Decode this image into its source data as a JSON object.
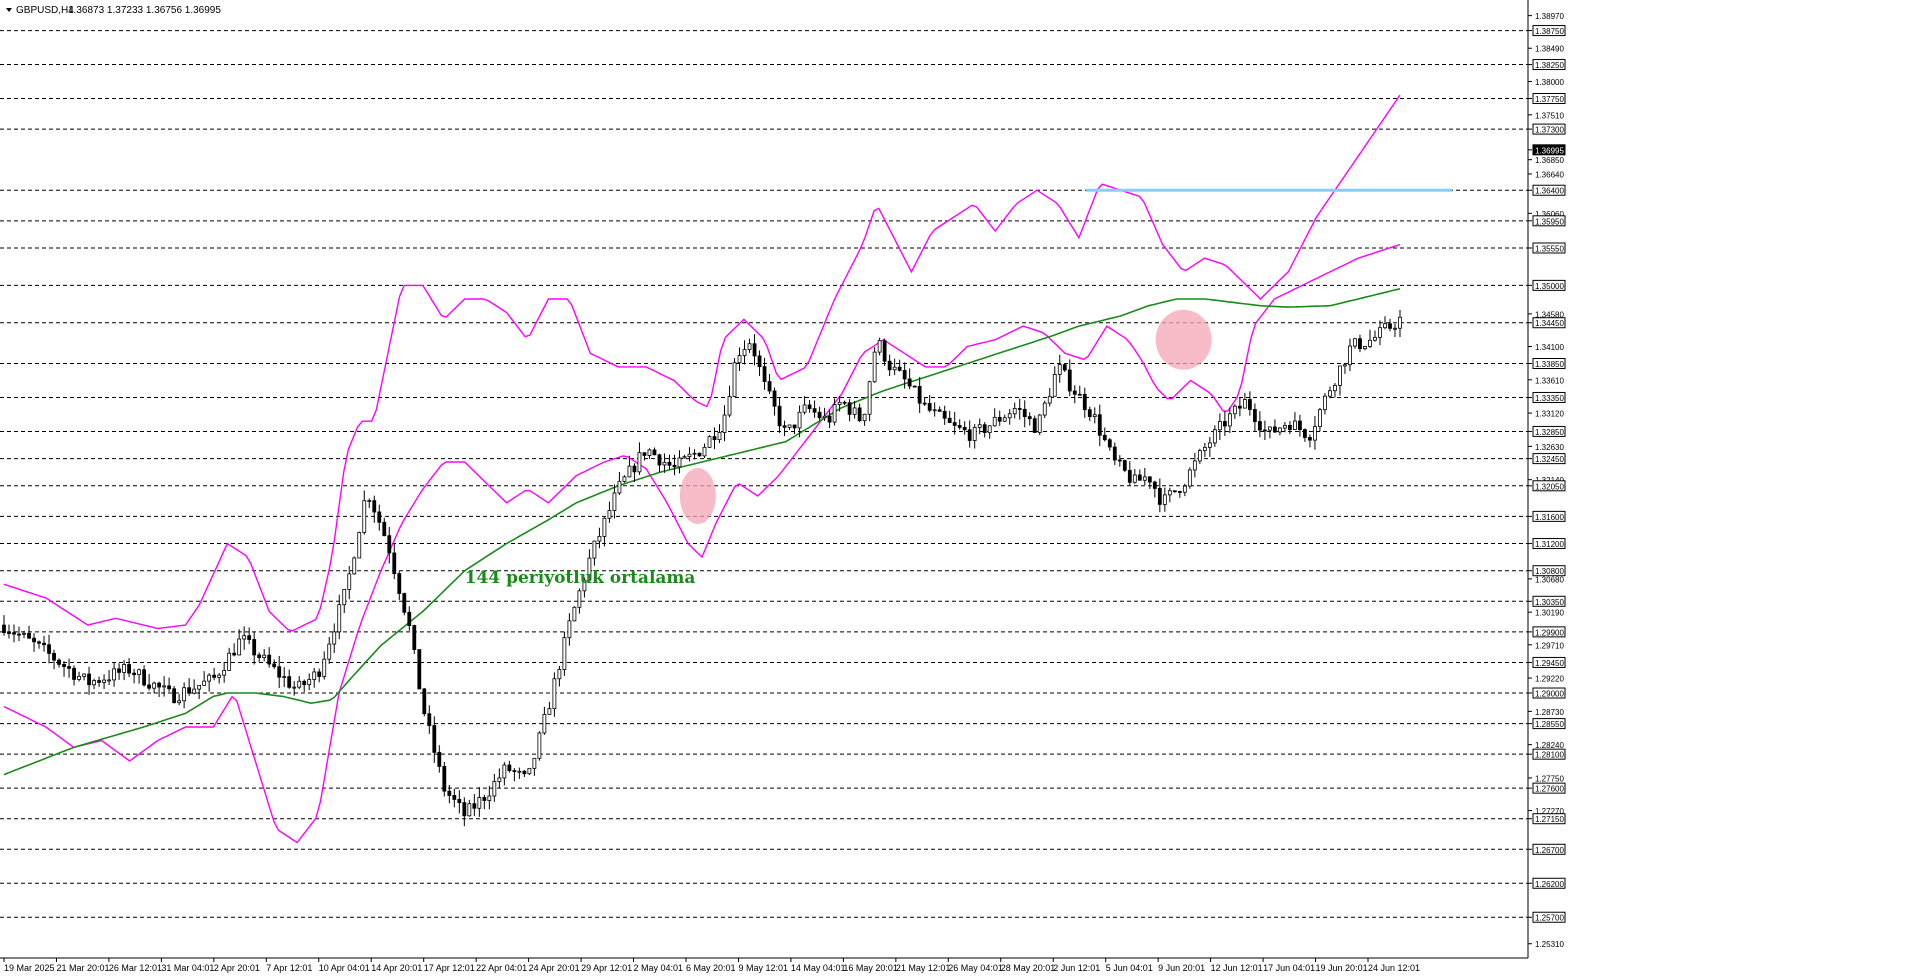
{
  "header": {
    "symbol": "GBPUSD,H4",
    "ohlc": "1.36873 1.37233 1.36756 1.36995"
  },
  "colors": {
    "background": "#ffffff",
    "grid": "#000000",
    "candle": "#000000",
    "bollinger": "#ff00ff",
    "ma144": "#1a8a1a",
    "resistance": "#87cefa",
    "highlight": "#f4a6b4",
    "last_price_bg": "#000000"
  },
  "chart_data": {
    "type": "candlestick",
    "title": "GBPUSD,H4",
    "ylim": [
      1.251,
      1.392
    ],
    "grid": "dashed horizontal at marked levels",
    "price_labels": [
      "1.38970",
      "1.38750",
      "1.38490",
      "1.38250",
      "1.38000",
      "1.37750",
      "1.37510",
      "1.37300",
      "1.36995",
      "1.36850",
      "1.36640",
      "1.36400",
      "1.36060",
      "1.35950",
      "1.35550",
      "1.35000",
      "1.34580",
      "1.34450",
      "1.34100",
      "1.33850",
      "1.33610",
      "1.33350",
      "1.33120",
      "1.32850",
      "1.32630",
      "1.32450",
      "1.32140",
      "1.32050",
      "1.31600",
      "1.31200",
      "1.30800",
      "1.30680",
      "1.30350",
      "1.30190",
      "1.29900",
      "1.29710",
      "1.29450",
      "1.29220",
      "1.29000",
      "1.28730",
      "1.28550",
      "1.28240",
      "1.28100",
      "1.27750",
      "1.27600",
      "1.27270",
      "1.27150",
      "1.26700",
      "1.26200",
      "1.25700",
      "1.25310"
    ],
    "highlighted_labels": [
      "1.38750",
      "1.38250",
      "1.37750",
      "1.37300",
      "1.36995",
      "1.36400",
      "1.35950",
      "1.35550",
      "1.35000",
      "1.34450",
      "1.33850",
      "1.33350",
      "1.32850",
      "1.32450",
      "1.32050",
      "1.31600",
      "1.31200",
      "1.30800",
      "1.30350",
      "1.29900",
      "1.29450",
      "1.29000",
      "1.28550",
      "1.28100",
      "1.27600",
      "1.27150",
      "1.26700",
      "1.26200",
      "1.25700"
    ],
    "dashed_levels": [
      1.3875,
      1.3825,
      1.3775,
      1.373,
      1.364,
      1.3595,
      1.3555,
      1.35,
      1.3445,
      1.3385,
      1.3335,
      1.3285,
      1.3245,
      1.3205,
      1.316,
      1.312,
      1.308,
      1.3035,
      1.299,
      1.2945,
      1.29,
      1.2855,
      1.281,
      1.276,
      1.2715,
      1.267,
      1.262,
      1.257
    ],
    "x_labels": [
      "19 Mar 2025",
      "21 Mar 20:01",
      "26 Mar 12:01",
      "31 Mar 04:01",
      "2 Apr 20:01",
      "7 Apr 12:01",
      "10 Apr 04:01",
      "14 Apr 20:01",
      "17 Apr 12:01",
      "22 Apr 04:01",
      "24 Apr 20:01",
      "29 Apr 12:01",
      "2 May 04:01",
      "6 May 20:01",
      "9 May 12:01",
      "14 May 04:01",
      "16 May 20:01",
      "21 May 12:01",
      "26 May 04:01",
      "28 May 20:01",
      "2 Jun 12:01",
      "5 Jun 04:01",
      "9 Jun 20:01",
      "12 Jun 12:01",
      "17 Jun 04:01",
      "19 Jun 20:01",
      "24 Jun 12:01"
    ],
    "price_path": [
      [
        0,
        1.3
      ],
      [
        0.03,
        1.296
      ],
      [
        0.06,
        1.2915
      ],
      [
        0.09,
        1.2935
      ],
      [
        0.12,
        1.2895
      ],
      [
        0.15,
        1.292
      ],
      [
        0.17,
        1.298
      ],
      [
        0.19,
        1.294
      ],
      [
        0.21,
        1.2905
      ],
      [
        0.225,
        1.293
      ],
      [
        0.245,
        1.305
      ],
      [
        0.26,
        1.32
      ],
      [
        0.275,
        1.312
      ],
      [
        0.29,
        1.3
      ],
      [
        0.3,
        1.288
      ],
      [
        0.315,
        1.276
      ],
      [
        0.33,
        1.272
      ],
      [
        0.345,
        1.275
      ],
      [
        0.36,
        1.279
      ],
      [
        0.375,
        1.277
      ],
      [
        0.39,
        1.288
      ],
      [
        0.405,
        1.3
      ],
      [
        0.42,
        1.31
      ],
      [
        0.44,
        1.32
      ],
      [
        0.46,
        1.326
      ],
      [
        0.48,
        1.323
      ],
      [
        0.5,
        1.326
      ],
      [
        0.515,
        1.33
      ],
      [
        0.525,
        1.34
      ],
      [
        0.535,
        1.342
      ],
      [
        0.545,
        1.335
      ],
      [
        0.56,
        1.328
      ],
      [
        0.575,
        1.332
      ],
      [
        0.59,
        1.33
      ],
      [
        0.6,
        1.333
      ],
      [
        0.615,
        1.33
      ],
      [
        0.625,
        1.342
      ],
      [
        0.635,
        1.338
      ],
      [
        0.645,
        1.336
      ],
      [
        0.66,
        1.332
      ],
      [
        0.68,
        1.329
      ],
      [
        0.695,
        1.328
      ],
      [
        0.71,
        1.33
      ],
      [
        0.725,
        1.332
      ],
      [
        0.74,
        1.329
      ],
      [
        0.755,
        1.338
      ],
      [
        0.765,
        1.335
      ],
      [
        0.78,
        1.331
      ],
      [
        0.795,
        1.324
      ],
      [
        0.81,
        1.321
      ],
      [
        0.82,
        1.322
      ],
      [
        0.83,
        1.318
      ],
      [
        0.845,
        1.321
      ],
      [
        0.86,
        1.326
      ],
      [
        0.875,
        1.33
      ],
      [
        0.89,
        1.333
      ],
      [
        0.905,
        1.328
      ],
      [
        0.92,
        1.33
      ],
      [
        0.935,
        1.328
      ],
      [
        0.95,
        1.335
      ],
      [
        0.965,
        1.341
      ],
      [
        0.98,
        1.342
      ],
      [
        1.0,
        1.345
      ]
    ],
    "series": [
      {
        "name": "144 periyotluk ortalama",
        "type": "line",
        "points": [
          [
            0,
            1.278
          ],
          [
            0.05,
            1.282
          ],
          [
            0.1,
            1.285
          ],
          [
            0.13,
            1.287
          ],
          [
            0.15,
            1.2895
          ],
          [
            0.16,
            1.29
          ],
          [
            0.18,
            1.29
          ],
          [
            0.2,
            1.2895
          ],
          [
            0.22,
            1.2885
          ],
          [
            0.235,
            1.289
          ],
          [
            0.25,
            1.2925
          ],
          [
            0.27,
            1.297
          ],
          [
            0.3,
            1.302
          ],
          [
            0.33,
            1.308
          ],
          [
            0.36,
            1.312
          ],
          [
            0.39,
            1.3155
          ],
          [
            0.41,
            1.318
          ],
          [
            0.44,
            1.3205
          ],
          [
            0.47,
            1.3225
          ],
          [
            0.5,
            1.324
          ],
          [
            0.53,
            1.3255
          ],
          [
            0.56,
            1.327
          ],
          [
            0.58,
            1.3295
          ],
          [
            0.6,
            1.332
          ],
          [
            0.63,
            1.3345
          ],
          [
            0.66,
            1.3365
          ],
          [
            0.69,
            1.3385
          ],
          [
            0.72,
            1.3405
          ],
          [
            0.75,
            1.3425
          ],
          [
            0.77,
            1.344
          ],
          [
            0.8,
            1.3455
          ],
          [
            0.82,
            1.347
          ],
          [
            0.84,
            1.348
          ],
          [
            0.86,
            1.348
          ],
          [
            0.88,
            1.3475
          ],
          [
            0.9,
            1.347
          ],
          [
            0.92,
            1.3468
          ],
          [
            0.95,
            1.347
          ],
          [
            0.97,
            1.348
          ],
          [
            1.0,
            1.3495
          ]
        ]
      },
      {
        "name": "",
        "type": "band-upper",
        "points": [
          [
            0,
            1.306
          ],
          [
            0.03,
            1.304
          ],
          [
            0.06,
            1.3
          ],
          [
            0.08,
            1.301
          ],
          [
            0.11,
            1.2995
          ],
          [
            0.13,
            1.3
          ],
          [
            0.14,
            1.303
          ],
          [
            0.16,
            1.312
          ],
          [
            0.175,
            1.31
          ],
          [
            0.19,
            1.302
          ],
          [
            0.205,
            1.299
          ],
          [
            0.225,
            1.301
          ],
          [
            0.235,
            1.31
          ],
          [
            0.245,
            1.325
          ],
          [
            0.255,
            1.33
          ],
          [
            0.265,
            1.33
          ],
          [
            0.275,
            1.34
          ],
          [
            0.285,
            1.35
          ],
          [
            0.3,
            1.35
          ],
          [
            0.315,
            1.345
          ],
          [
            0.33,
            1.348
          ],
          [
            0.345,
            1.348
          ],
          [
            0.36,
            1.346
          ],
          [
            0.375,
            1.342
          ],
          [
            0.39,
            1.348
          ],
          [
            0.405,
            1.348
          ],
          [
            0.42,
            1.34
          ],
          [
            0.44,
            1.338
          ],
          [
            0.46,
            1.338
          ],
          [
            0.48,
            1.336
          ],
          [
            0.495,
            1.333
          ],
          [
            0.505,
            1.332
          ],
          [
            0.515,
            1.342
          ],
          [
            0.53,
            1.345
          ],
          [
            0.545,
            1.342
          ],
          [
            0.555,
            1.336
          ],
          [
            0.575,
            1.338
          ],
          [
            0.595,
            1.348
          ],
          [
            0.615,
            1.356
          ],
          [
            0.625,
            1.362
          ],
          [
            0.635,
            1.358
          ],
          [
            0.65,
            1.352
          ],
          [
            0.665,
            1.358
          ],
          [
            0.68,
            1.36
          ],
          [
            0.695,
            1.362
          ],
          [
            0.71,
            1.358
          ],
          [
            0.725,
            1.362
          ],
          [
            0.74,
            1.364
          ],
          [
            0.755,
            1.362
          ],
          [
            0.77,
            1.357
          ],
          [
            0.785,
            1.365
          ],
          [
            0.8,
            1.364
          ],
          [
            0.815,
            1.363
          ],
          [
            0.83,
            1.356
          ],
          [
            0.845,
            1.352
          ],
          [
            0.86,
            1.354
          ],
          [
            0.875,
            1.353
          ],
          [
            0.885,
            1.351
          ],
          [
            0.9,
            1.348
          ],
          [
            0.92,
            1.352
          ],
          [
            0.94,
            1.36
          ],
          [
            0.96,
            1.366
          ],
          [
            0.98,
            1.372
          ],
          [
            1.0,
            1.378
          ]
        ]
      },
      {
        "name": "",
        "type": "band-lower",
        "points": [
          [
            0,
            1.288
          ],
          [
            0.03,
            1.285
          ],
          [
            0.05,
            1.282
          ],
          [
            0.07,
            1.283
          ],
          [
            0.09,
            1.28
          ],
          [
            0.11,
            1.283
          ],
          [
            0.13,
            1.285
          ],
          [
            0.15,
            1.285
          ],
          [
            0.165,
            1.29
          ],
          [
            0.18,
            1.28
          ],
          [
            0.195,
            1.27
          ],
          [
            0.21,
            1.268
          ],
          [
            0.225,
            1.272
          ],
          [
            0.24,
            1.29
          ],
          [
            0.255,
            1.3
          ],
          [
            0.27,
            1.308
          ],
          [
            0.285,
            1.315
          ],
          [
            0.3,
            1.32
          ],
          [
            0.315,
            1.324
          ],
          [
            0.33,
            1.324
          ],
          [
            0.345,
            1.321
          ],
          [
            0.36,
            1.318
          ],
          [
            0.375,
            1.32
          ],
          [
            0.39,
            1.318
          ],
          [
            0.41,
            1.322
          ],
          [
            0.43,
            1.324
          ],
          [
            0.445,
            1.325
          ],
          [
            0.46,
            1.323
          ],
          [
            0.475,
            1.318
          ],
          [
            0.49,
            1.312
          ],
          [
            0.5,
            1.31
          ],
          [
            0.51,
            1.315
          ],
          [
            0.525,
            1.321
          ],
          [
            0.54,
            1.319
          ],
          [
            0.555,
            1.322
          ],
          [
            0.57,
            1.326
          ],
          [
            0.585,
            1.33
          ],
          [
            0.6,
            1.334
          ],
          [
            0.615,
            1.34
          ],
          [
            0.63,
            1.342
          ],
          [
            0.645,
            1.34
          ],
          [
            0.66,
            1.338
          ],
          [
            0.675,
            1.338
          ],
          [
            0.69,
            1.341
          ],
          [
            0.71,
            1.342
          ],
          [
            0.73,
            1.344
          ],
          [
            0.745,
            1.343
          ],
          [
            0.76,
            1.34
          ],
          [
            0.775,
            1.339
          ],
          [
            0.79,
            1.344
          ],
          [
            0.805,
            1.342
          ],
          [
            0.815,
            1.339
          ],
          [
            0.825,
            1.335
          ],
          [
            0.835,
            1.333
          ],
          [
            0.85,
            1.336
          ],
          [
            0.865,
            1.334
          ],
          [
            0.875,
            1.331
          ],
          [
            0.885,
            1.334
          ],
          [
            0.895,
            1.344
          ],
          [
            0.91,
            1.348
          ],
          [
            0.93,
            1.35
          ],
          [
            0.95,
            1.352
          ],
          [
            0.97,
            1.354
          ],
          [
            1.0,
            1.356
          ]
        ]
      }
    ],
    "resistance_level": 1.364,
    "resistance_x_range": [
      0.775,
      0.945
    ],
    "highlight_zones": [
      {
        "x": 0.497,
        "y": 1.319
      },
      {
        "x": 0.845,
        "y": 1.342
      }
    ],
    "annotations": [
      {
        "text": "144 periyotluk ortalama",
        "x": 0.33,
        "y": 1.3062
      }
    ]
  }
}
